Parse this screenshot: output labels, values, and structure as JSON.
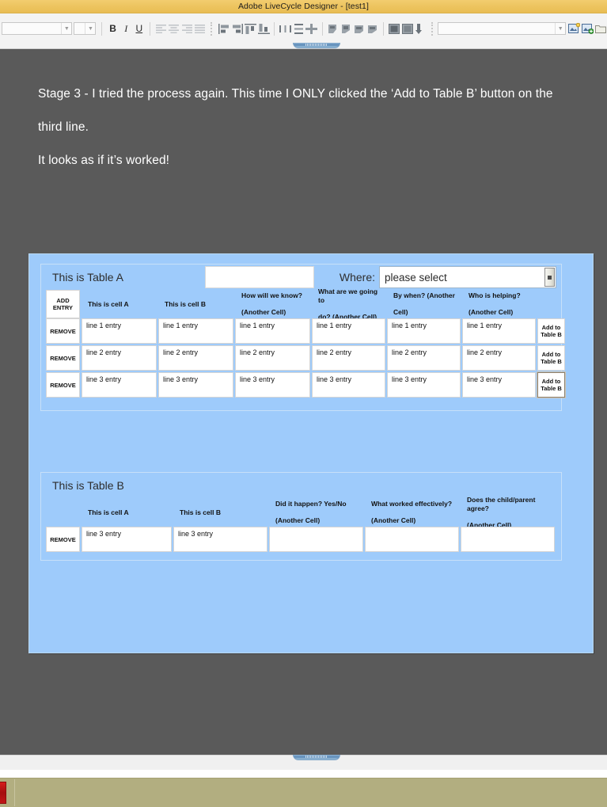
{
  "window": {
    "title": "Adobe LiveCycle Designer - [test1]"
  },
  "toolbar": {
    "font_combo_value": "",
    "size_combo_value": "",
    "object_combo_value": "",
    "buttons": [
      {
        "name": "bold",
        "label": "B"
      },
      {
        "name": "italic",
        "label": "I"
      },
      {
        "name": "underline",
        "label": "U"
      }
    ]
  },
  "document": {
    "paragraphs": [
      "Stage 3 - I tried the process again. This time I ONLY clicked the ‘Add to Table B’ button on the",
      "third line.",
      "It looks as if it’s worked!"
    ]
  },
  "form": {
    "table_a": {
      "title": "This is Table A",
      "blank_field_value": "",
      "where_label": "Where:",
      "where_value": "please select",
      "add_entry_label": "ADD ENTRY",
      "headers": [
        "",
        "This is cell A",
        "This is cell B",
        "How will we know? (Another Cell)",
        "What are we going to do? (Another Cell)",
        "By when? (Another Cell)",
        "Who is helping? (Another Cell)",
        ""
      ],
      "header_lines": [
        [
          "",
          ""
        ],
        [
          "This is cell A",
          ""
        ],
        [
          "This is cell B",
          ""
        ],
        [
          "How will we know?",
          "(Another Cell)"
        ],
        [
          "What are we going to",
          "do? (Another Cell)"
        ],
        [
          "By when? (Another",
          "Cell)"
        ],
        [
          "Who is helping?",
          "(Another Cell)"
        ],
        [
          "",
          ""
        ]
      ],
      "remove_label": "REMOVE",
      "add_to_table_b_label_line1": "Add to",
      "add_to_table_b_label_line2": "Table B",
      "rows": [
        {
          "remove": "REMOVE",
          "cells": [
            "line 1 entry",
            "line 1 entry",
            "line 1 entry",
            "line 1 entry",
            "line 1 entry",
            "line 1 entry"
          ],
          "focused": false
        },
        {
          "remove": "REMOVE",
          "cells": [
            "line 2 entry",
            "line 2 entry",
            "line 2 entry",
            "line 2 entry",
            "line 2 entry",
            "line 2 entry"
          ],
          "focused": false
        },
        {
          "remove": "REMOVE",
          "cells": [
            "line 3 entry",
            "line 3 entry",
            "line 3 entry",
            "line 3 entry",
            "line 3 entry",
            "line 3 entry"
          ],
          "focused": true
        }
      ]
    },
    "table_b": {
      "title": "This is Table B",
      "header_lines": [
        [
          "",
          ""
        ],
        [
          "This is cell A",
          ""
        ],
        [
          "This is cell B",
          ""
        ],
        [
          "Did it happen? Yes/No",
          "(Another Cell)"
        ],
        [
          "What worked effectively?",
          "(Another Cell)"
        ],
        [
          "Does the child/parent agree?",
          "(Another Cell)"
        ]
      ],
      "rows": [
        {
          "remove": "REMOVE",
          "cells": [
            "line 3 entry",
            "line 3 entry",
            "",
            "",
            ""
          ]
        }
      ]
    }
  },
  "colors": {
    "titlebar": "#edc45f",
    "workspace": "#5a5a5a",
    "form_background": "#9ecbfb",
    "taskbar": "#b2ae80",
    "accent_grip": "#5d8bb8"
  }
}
